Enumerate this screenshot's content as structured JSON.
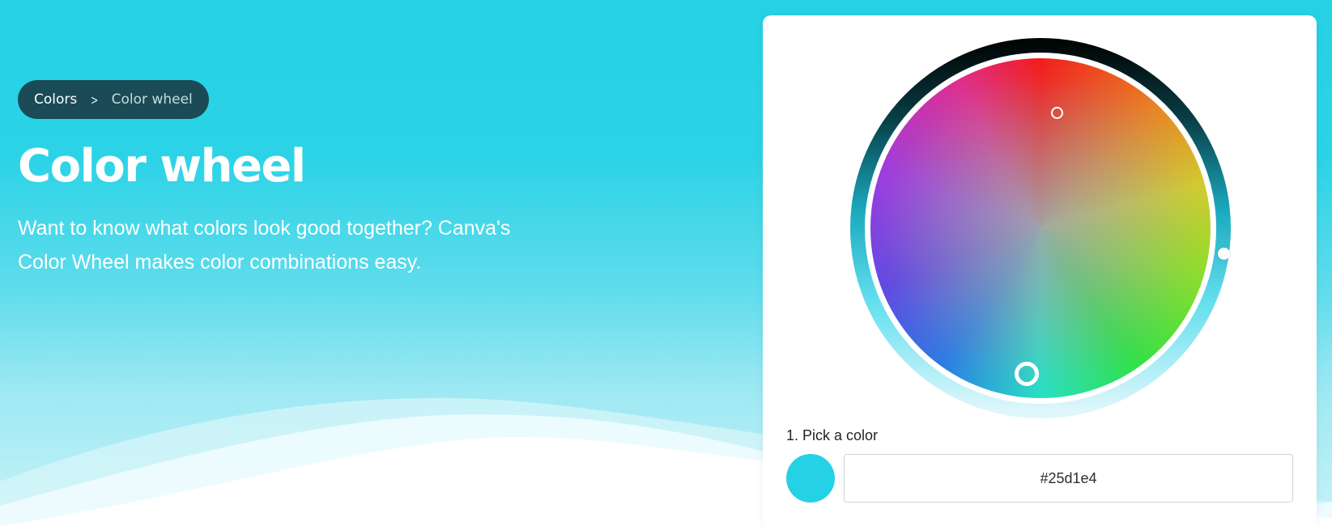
{
  "breadcrumb": {
    "parent": "Colors",
    "separator_icon": "chevron-right-icon",
    "current": "Color wheel"
  },
  "hero": {
    "title": "Color wheel",
    "subtitle": "Want to know what colors look good together? Canva's Color Wheel makes color combinations easy."
  },
  "picker": {
    "step_label": "1. Pick a color",
    "hex_value": "#25d1e4",
    "selected_color": "#25d1e4"
  },
  "colors": {
    "background": "#25d1e4",
    "breadcrumb_bg": "#1a4b57",
    "card_bg": "#ffffff"
  }
}
